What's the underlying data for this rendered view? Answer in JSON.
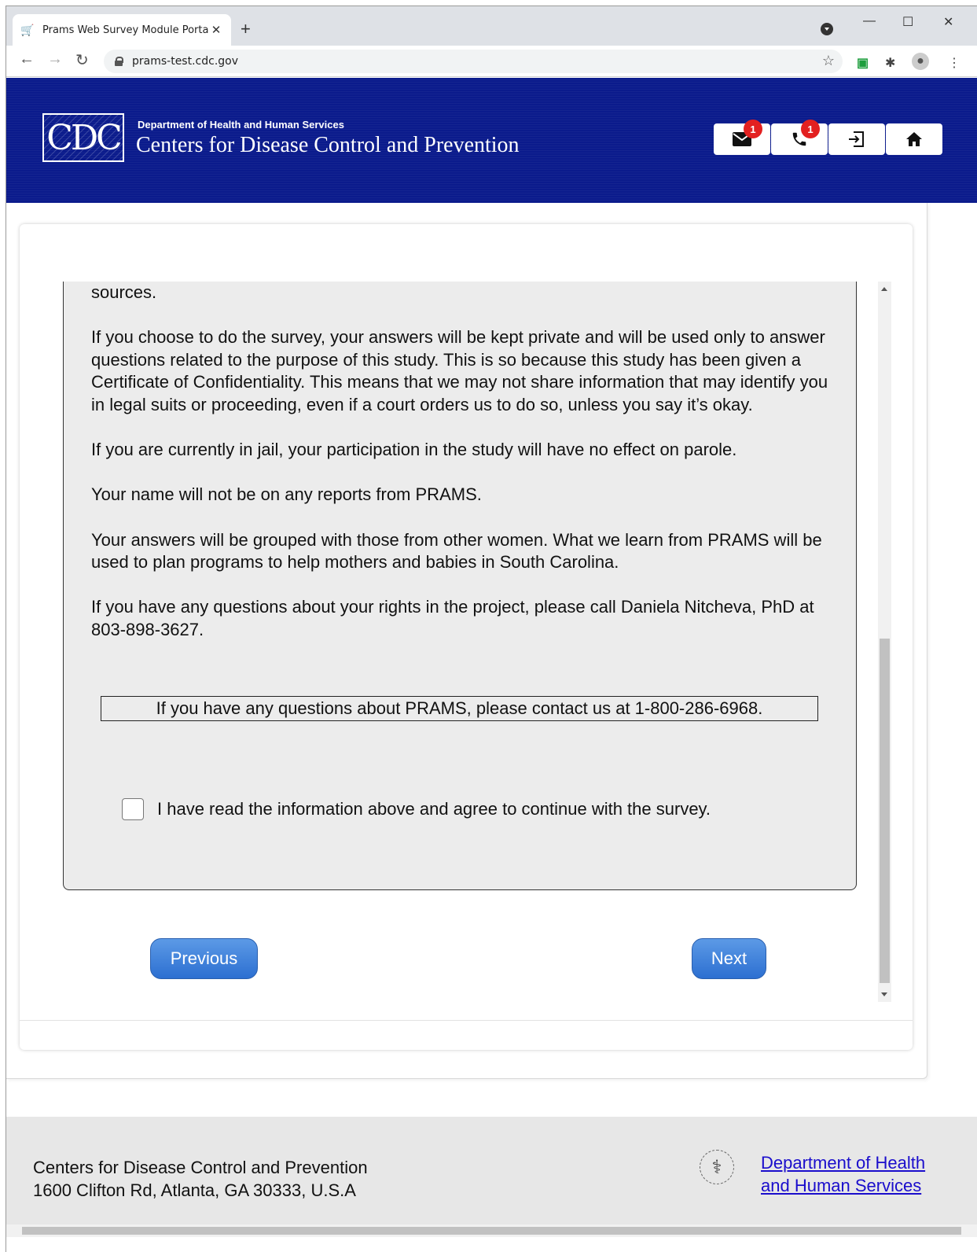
{
  "browser": {
    "tab_title": "Prams Web Survey Module Portal",
    "tab_close": "✕",
    "new_tab": "+",
    "url": "prams-test.cdc.gov",
    "minimize": "—",
    "maximize": "☐",
    "close": "✕"
  },
  "header": {
    "logo_text": "CDC",
    "dept_small": "Department of Health and Human Services",
    "dept_big": "Centers for Disease Control and Prevention",
    "mail_badge": "1",
    "phone_badge": "1"
  },
  "consent": {
    "paragraphs": [
      "sources.",
      "If you choose to do the survey, your answers will be kept private and will be used only to answer questions related to the purpose of this study. This is so because this study has been given a Certificate of Confidentiality. This means that we may not share information that may identify you in legal suits or proceeding, even if a court orders us to do so, unless you say it’s okay.",
      "If you are currently in jail, your participation in the study will have no effect on parole.",
      "Your name will not be on any reports from PRAMS.",
      "Your answers will be grouped with those from other women. What we learn from PRAMS will be used to plan programs to help mothers and babies in South Carolina.",
      "If you have any questions about your rights in the project, please call Daniela Nitcheva, PhD at 803-898-3627."
    ],
    "contact": "If you have any questions about PRAMS, please contact us at 1-800-286-6968.",
    "agree_label": "I have read the information above and agree to continue with the survey.",
    "agree_checked": false
  },
  "buttons": {
    "previous": "Previous",
    "next": "Next"
  },
  "footer": {
    "org_line1": "Centers for Disease Control and Prevention",
    "org_line2": "1600 Clifton Rd, Atlanta, GA 30333, U.S.A",
    "hhs_link_line1": "Department of Health",
    "hhs_link_line2": "and Human Services"
  }
}
